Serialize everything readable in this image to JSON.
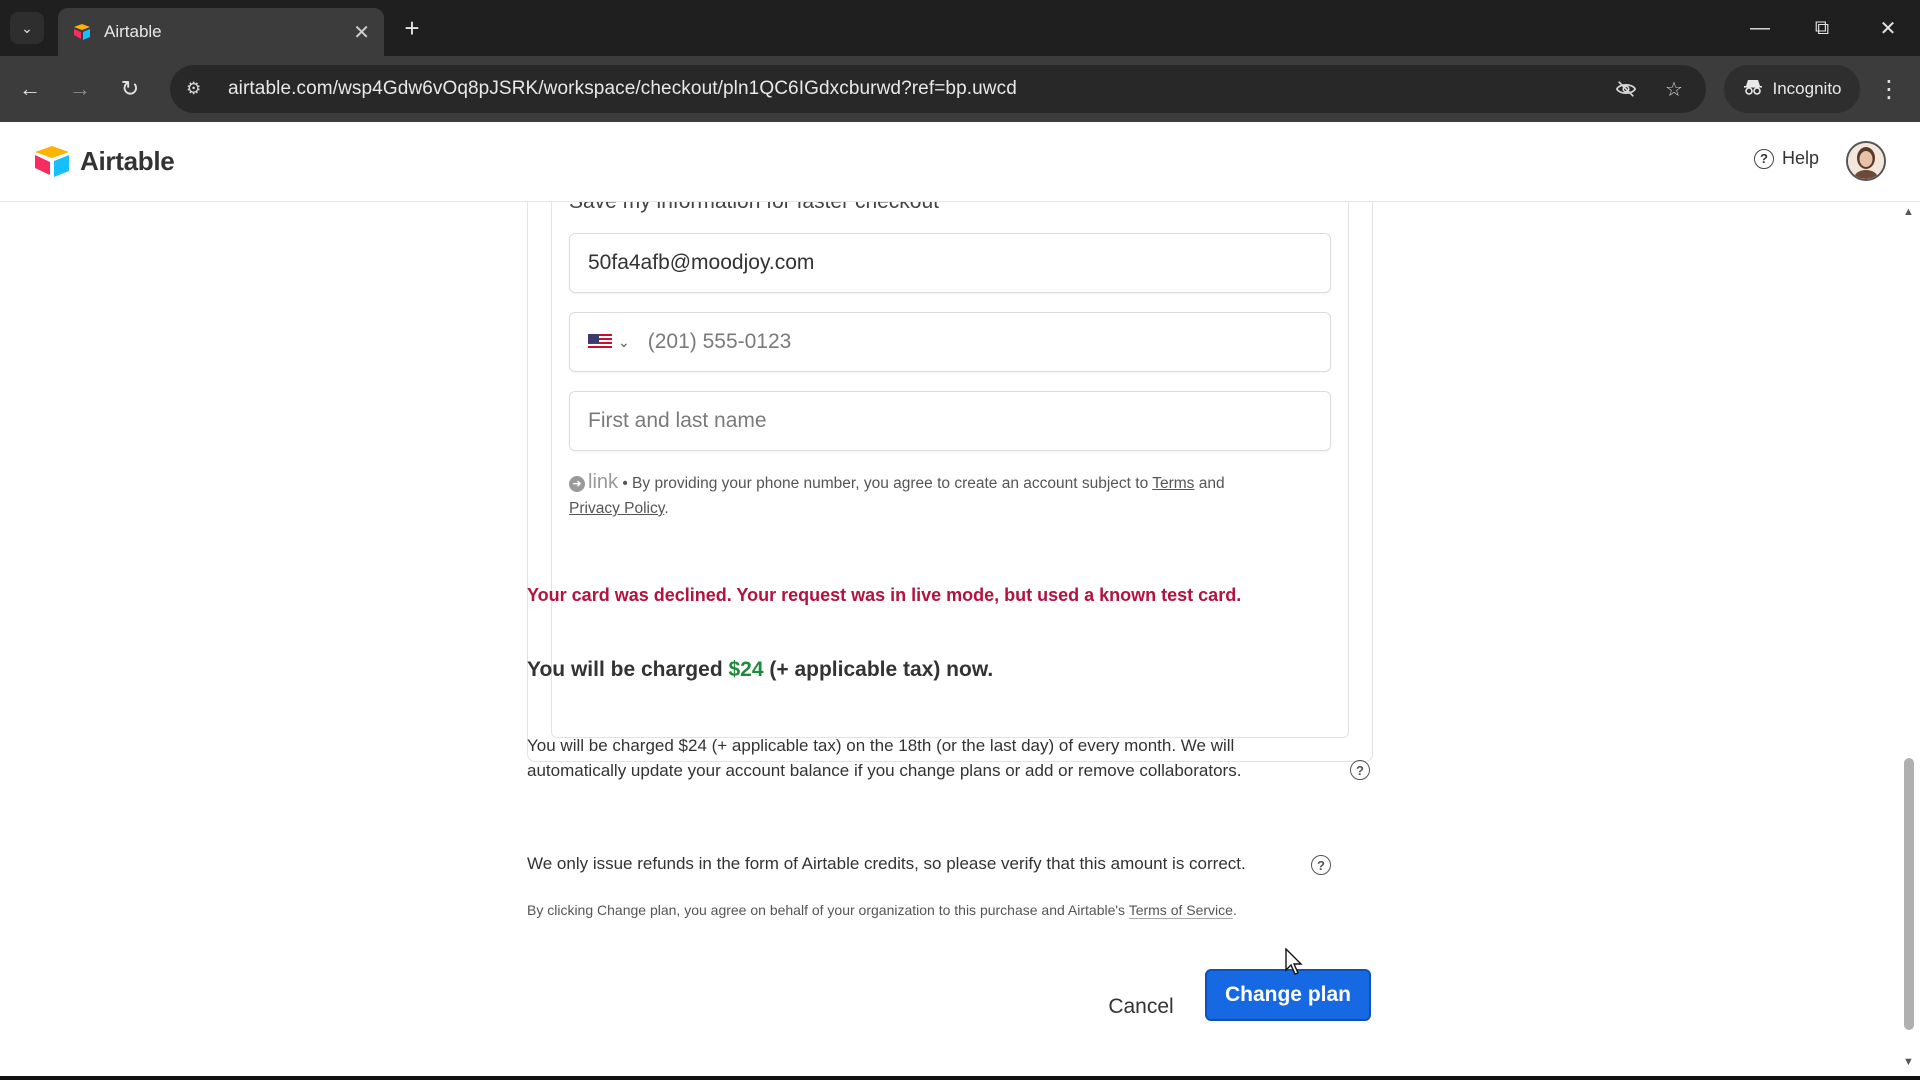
{
  "browser": {
    "tab_title": "Airtable",
    "url": "airtable.com/wsp4Gdw6vOq8pJSRK/workspace/checkout/pln1QC6IGdxcburwd?ref=bp.uwcd",
    "incognito_label": "Incognito"
  },
  "header": {
    "brand": "Airtable",
    "help_label": "Help"
  },
  "checkout": {
    "save_info_label": "Save my information for faster checkout",
    "email_value": "50fa4afb@moodjoy.com",
    "phone_placeholder": "(201) 555-0123",
    "name_placeholder": "First and last name",
    "link_logo": "link",
    "link_note_pre": " • By providing your phone number, you agree to create an account subject to ",
    "link_terms": "Terms",
    "link_and": " and",
    "link_privacy": "Privacy Policy",
    "link_end": ".",
    "error": "Your card was declined. Your request was in live mode, but used a known test card.",
    "charged_pre": "You will be charged ",
    "charged_amount": "$24",
    "charged_post": " (+ applicable tax) now.",
    "recurring_text": "You will be charged $24 (+ applicable tax) on the 18th (or the last day) of every month. We will automatically update your account balance if you change plans or add or remove collaborators.",
    "refund_text": "We only issue refunds in the form of Airtable credits, so please verify that this amount is correct.",
    "terms_pre": "By clicking Change plan, you agree on behalf of your organization to this purchase and Airtable's ",
    "terms_link": "Terms of Service",
    "terms_end": ".",
    "cancel_label": "Cancel",
    "change_plan_label": "Change plan"
  },
  "colors": {
    "error": "#b5123e",
    "amount": "#1e8a3c",
    "primary_button": "#1769e3"
  }
}
